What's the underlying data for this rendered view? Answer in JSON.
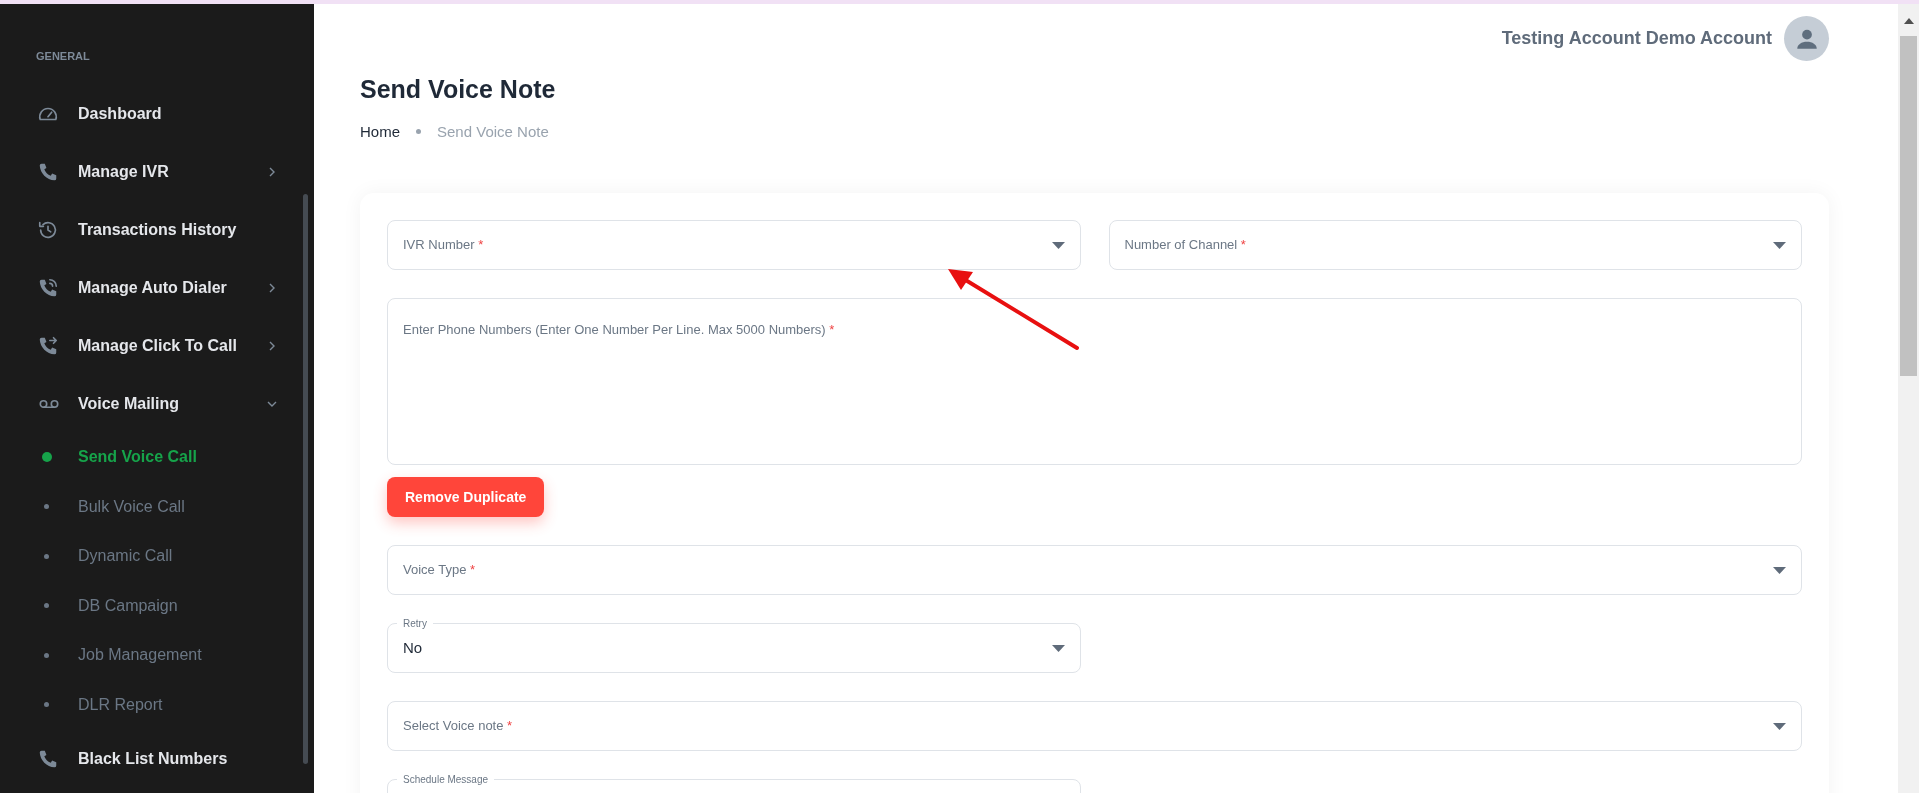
{
  "sidebar": {
    "section_label": "GENERAL",
    "items": [
      {
        "label": "Dashboard"
      },
      {
        "label": "Manage IVR",
        "expanded": false
      },
      {
        "label": "Transactions History"
      },
      {
        "label": "Manage Auto Dialer",
        "expanded": false
      },
      {
        "label": "Manage Click To Call",
        "expanded": false
      },
      {
        "label": "Voice Mailing",
        "expanded": true,
        "children": [
          {
            "label": "Send Voice Call",
            "selected": true
          },
          {
            "label": "Bulk Voice Call",
            "selected": false
          },
          {
            "label": "Dynamic Call",
            "selected": false
          },
          {
            "label": "DB Campaign",
            "selected": false
          },
          {
            "label": "Job Management",
            "selected": false
          },
          {
            "label": "DLR Report",
            "selected": false
          }
        ]
      },
      {
        "label": "Black List Numbers"
      }
    ]
  },
  "header": {
    "user_name": "Testing Account Demo Account"
  },
  "page": {
    "title": "Send Voice Note",
    "breadcrumb": [
      "Home",
      "Send Voice Note"
    ]
  },
  "form": {
    "fields": [
      {
        "kind": "select",
        "label": "IVR Number",
        "required_mark": "*"
      },
      {
        "kind": "select",
        "label": "Number of Channel",
        "required_mark": "*"
      },
      {
        "kind": "textarea",
        "label": "Enter Phone Numbers (Enter One Number Per Line. Max 5000 Numbers)",
        "required_mark": "*"
      },
      {
        "kind": "button",
        "label": "Remove Duplicate"
      },
      {
        "kind": "select",
        "label": "Voice Type",
        "required_mark": "*"
      },
      {
        "kind": "select",
        "label": "Retry",
        "value": "No"
      },
      {
        "kind": "select",
        "label": "Select Voice note",
        "required_mark": "*"
      },
      {
        "kind": "date",
        "label": "Schedule Message"
      }
    ]
  }
}
